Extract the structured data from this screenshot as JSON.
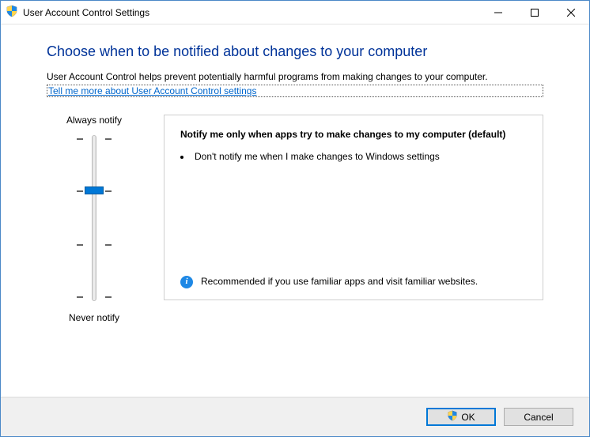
{
  "window": {
    "title": "User Account Control Settings"
  },
  "content": {
    "heading": "Choose when to be notified about changes to your computer",
    "description": "User Account Control helps prevent potentially harmful programs from making changes to your computer.",
    "link": "Tell me more about User Account Control settings"
  },
  "slider": {
    "top_label": "Always notify",
    "bottom_label": "Never notify",
    "levels": 4,
    "selected_index": 1
  },
  "panel": {
    "title": "Notify me only when apps try to make changes to my computer (default)",
    "bullets": [
      "Don't notify me when I make changes to Windows settings"
    ],
    "recommendation": "Recommended if you use familiar apps and visit familiar websites."
  },
  "buttons": {
    "ok": "OK",
    "cancel": "Cancel"
  }
}
